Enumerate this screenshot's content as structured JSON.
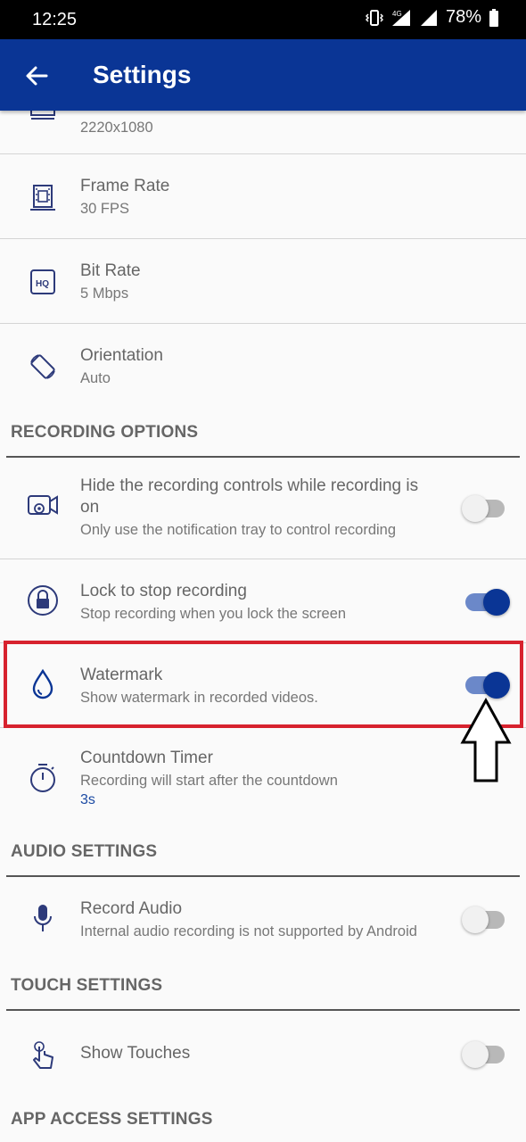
{
  "status_bar": {
    "time": "12:25",
    "battery": "78%",
    "network": "4G"
  },
  "app_bar": {
    "title": "Settings",
    "back_icon": "arrow-left-icon"
  },
  "rows": {
    "resolution": {
      "subtitle": "2220x1080"
    },
    "frame_rate": {
      "title": "Frame Rate",
      "subtitle": "30 FPS"
    },
    "bit_rate": {
      "title": "Bit Rate",
      "subtitle": "5 Mbps"
    },
    "orientation": {
      "title": "Orientation",
      "subtitle": "Auto"
    },
    "hide_controls": {
      "title": "Hide the recording controls while recording is on",
      "subtitle": "Only use the notification tray to control recording",
      "enabled": false
    },
    "lock_stop": {
      "title": "Lock to stop recording",
      "subtitle": "Stop recording when you lock the screen",
      "enabled": true
    },
    "watermark": {
      "title": "Watermark",
      "subtitle": "Show watermark in recorded videos.",
      "enabled": true
    },
    "countdown": {
      "title": "Countdown Timer",
      "subtitle": "Recording will start after the countdown",
      "value": "3s"
    },
    "record_audio": {
      "title": "Record Audio",
      "subtitle": "Internal audio recording is not supported by Android",
      "enabled": false
    },
    "show_touches": {
      "title": "Show Touches",
      "enabled": false
    }
  },
  "sections": {
    "recording_options": "RECORDING OPTIONS",
    "audio_settings": "AUDIO SETTINGS",
    "touch_settings": "TOUCH SETTINGS",
    "app_access_settings": "APP ACCESS SETTINGS"
  },
  "colors": {
    "primary": "#0a3595",
    "highlight": "#d7222e",
    "value_text": "#1b4aa3"
  }
}
